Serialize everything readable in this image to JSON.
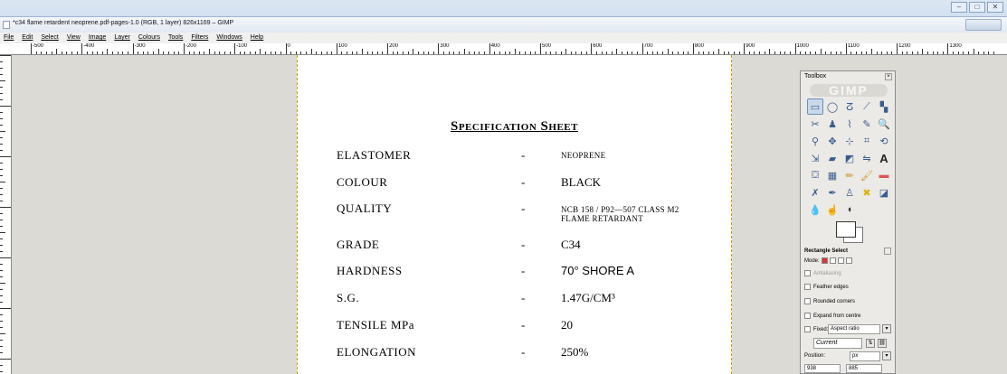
{
  "window": {
    "title": "*c34 flame retardent neoprene.pdf-pages-1.0 (RGB, 1 layer) 826x1169 – GIMP"
  },
  "menu": [
    "File",
    "Edit",
    "Select",
    "View",
    "Image",
    "Layer",
    "Colours",
    "Tools",
    "Filters",
    "Windows",
    "Help"
  ],
  "ruler": {
    "h_labels": [
      "-500",
      "-400",
      "-300",
      "-200",
      "-100",
      "0",
      "100",
      "200",
      "300",
      "400",
      "500",
      "600",
      "700",
      "800",
      "900",
      "1000",
      "1100",
      "1200",
      "1300"
    ],
    "v_labels": [
      "100",
      "200",
      "300",
      "400",
      "500"
    ]
  },
  "sheet": {
    "title": "Specification Sheet",
    "rows": [
      {
        "key": "ELASTOMER",
        "dash": "-",
        "value": "NEOPRENE"
      },
      {
        "key": "COLOUR",
        "dash": "-",
        "value": "BLACK"
      },
      {
        "key": "QUALITY",
        "dash": "-",
        "value": "NCB 158 / P92—507 CLASS M2",
        "value2": "FLAME RETARDANT"
      },
      {
        "key": "GRADE",
        "dash": "-",
        "value": "C34"
      },
      {
        "key": "HARDNESS",
        "dash": "-",
        "value": "70° SHORE A"
      },
      {
        "key": "S.G.",
        "dash": "-",
        "value": "1.47G/CM³"
      },
      {
        "key": "TENSILE MPa",
        "dash": "-",
        "value": "20"
      },
      {
        "key": "ELONGATION",
        "dash": "-",
        "value": "250%"
      }
    ]
  },
  "toolbox": {
    "title": "Toolbox",
    "logo": "GIMP",
    "tool_options_title": "Rectangle Select",
    "mode_label": "Mode:",
    "antialiasing": "Antialiasing",
    "feather": "Feather edges",
    "rounded": "Rounded corners",
    "expand": "Expand from centre",
    "fixed_label": "Fixed:",
    "fixed_value": "Aspect ratio",
    "current": "Current",
    "position_label": "Position:",
    "unit": "px",
    "pos_x": "938",
    "pos_y": "885"
  }
}
